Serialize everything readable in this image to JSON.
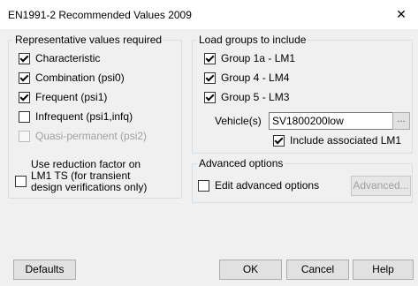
{
  "window": {
    "title": "EN1991-2 Recommended Values 2009",
    "close_glyph": "✕"
  },
  "representative": {
    "title": "Representative values required",
    "items": [
      {
        "label": "Characteristic",
        "checked": true,
        "enabled": true
      },
      {
        "label": "Combination (psi0)",
        "checked": true,
        "enabled": true
      },
      {
        "label": "Frequent (psi1)",
        "checked": true,
        "enabled": true
      },
      {
        "label": "Infrequent (psi1,infq)",
        "checked": false,
        "enabled": true
      },
      {
        "label": "Quasi-permanent (psi2)",
        "checked": false,
        "enabled": false
      }
    ]
  },
  "load_groups": {
    "title": "Load groups to include",
    "items": [
      {
        "label": "Group 1a - LM1",
        "checked": true
      },
      {
        "label": "Group 4 - LM4",
        "checked": true
      },
      {
        "label": "Group 5 - LM3",
        "checked": true
      }
    ],
    "vehicle_label": "Vehicle(s)",
    "vehicle_value": "SV1800200low",
    "browse_label": "...",
    "include_lm1_label": "Include associated LM1",
    "include_lm1_checked": true
  },
  "reduction": {
    "label_line1": "Use reduction factor on",
    "label_line2": "LM1 TS (for transient",
    "label_line3": "design verifications only)",
    "checked": false
  },
  "advanced": {
    "title": "Advanced options",
    "edit_label": "Edit advanced options",
    "edit_checked": false,
    "button_label": "Advanced..."
  },
  "buttons": {
    "defaults": "Defaults",
    "ok": "OK",
    "cancel": "Cancel",
    "help": "Help"
  }
}
